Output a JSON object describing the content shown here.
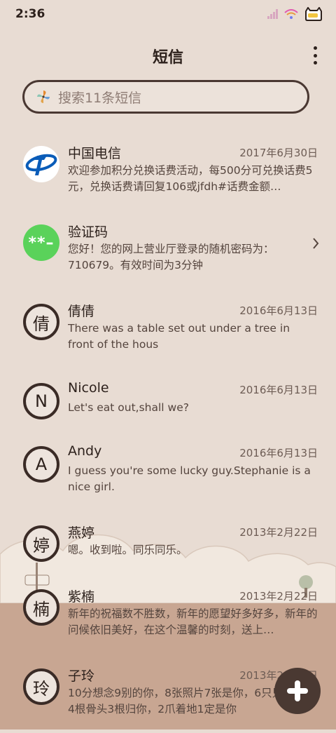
{
  "status_bar": {
    "time": "2:36"
  },
  "header": {
    "title": "短信"
  },
  "search": {
    "placeholder": "搜索11条短信"
  },
  "messages": [
    {
      "name": "中国电信",
      "date": "2017年6月30日",
      "preview": "欢迎参加积分兑换话费活动，每500分可兑换话费5元，兑换话费请回复106或jfdh#话费金额…",
      "avatar_type": "telecom-logo"
    },
    {
      "name": "验证码",
      "date": "",
      "preview": "您好！您的网上营业厅登录的随机密码为：710679。有效时间为3分钟",
      "avatar_text": "**–",
      "avatar_type": "green"
    },
    {
      "name": "倩倩",
      "date": "2016年6月13日",
      "preview": "There was a table set out under a tree in front of the hous",
      "avatar_text": "倩"
    },
    {
      "name": "Nicole",
      "date": "2016年6月13日",
      "preview": "Let's eat out,shall we?",
      "avatar_text": "N"
    },
    {
      "name": "Andy",
      "date": "2016年6月13日",
      "preview": "I guess you're some lucky guy.Stephanie is a nice girl.",
      "avatar_text": "A"
    },
    {
      "name": "燕婷",
      "date": "2013年2月22日",
      "preview": "嗯。收到啦。同乐同乐。",
      "avatar_text": "婷"
    },
    {
      "name": "紫楠",
      "date": "2013年2月22日",
      "preview": "新年的祝福数不胜数，新年的愿望好多好多，新年的问候依旧美好，在这个温馨的时刻，送上…",
      "avatar_text": "楠"
    },
    {
      "name": "子玲",
      "date": "2013年2月22日",
      "preview": "10分想念9别的你，8张照片7张是你，6只只像你，4根骨头3根归你，2爪着地1定是你",
      "avatar_text": "玲"
    }
  ],
  "colors": {
    "background": "#e8dcd3",
    "text": "#2d211c",
    "fab": "#4a3932",
    "telecom_blue": "#0a5cb8",
    "verify_green": "#5ad25a"
  }
}
